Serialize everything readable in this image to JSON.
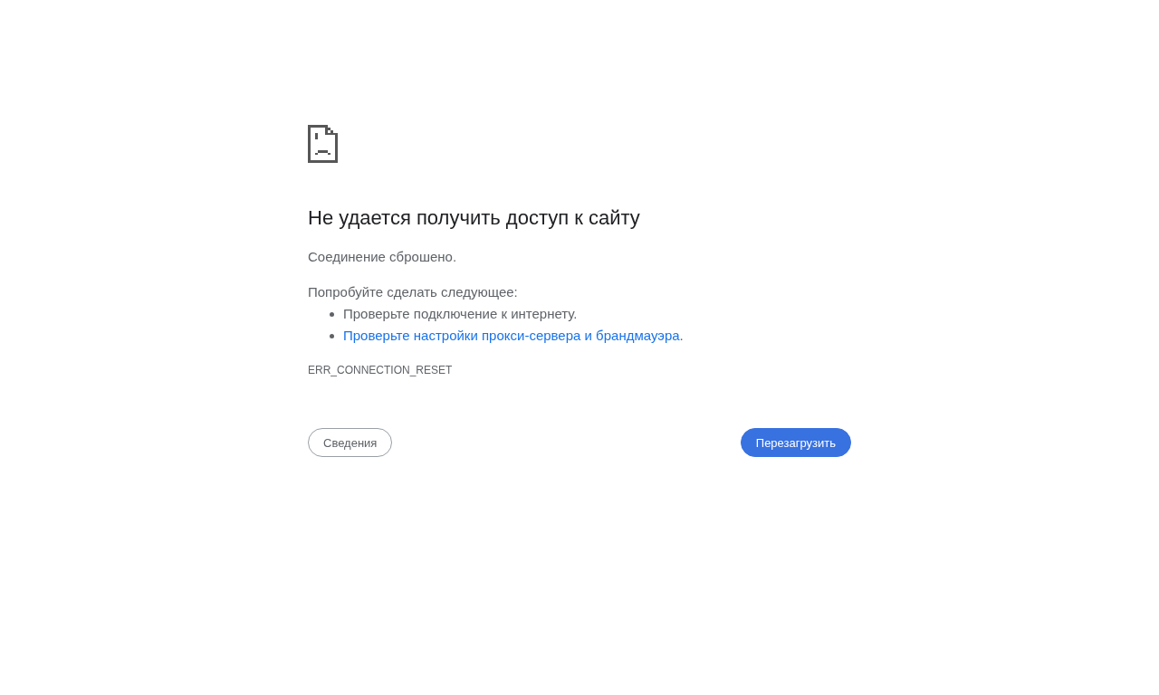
{
  "title": "Не удается получить доступ к сайту",
  "message": "Соединение сброшено.",
  "suggestions_heading": "Попробуйте сделать следующее:",
  "suggestions": [
    {
      "kind": "text",
      "text": "Проверьте подключение к интернету."
    },
    {
      "kind": "link",
      "link": "Проверьте настройки прокси-сервера и брандмауэра",
      "after": "."
    }
  ],
  "error_code": "ERR_CONNECTION_RESET",
  "buttons": [
    {
      "kind": "secondary",
      "label": "Сведения"
    },
    {
      "kind": "primary",
      "label": "Перезагрузить"
    }
  ]
}
